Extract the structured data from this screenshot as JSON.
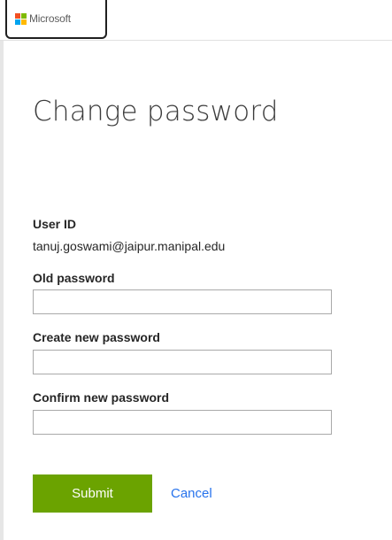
{
  "header": {
    "logo_text": "Microsoft",
    "logo_colors": [
      "#f25022",
      "#7fba00",
      "#00a4ef",
      "#ffb900"
    ]
  },
  "main": {
    "title": "Change password",
    "user_id_label": "User ID",
    "user_id_value": "tanuj.goswami@jaipur.manipal.edu",
    "old_password_label": "Old password",
    "old_password_value": "",
    "new_password_label": "Create new password",
    "new_password_value": "",
    "confirm_password_label": "Confirm new password",
    "confirm_password_value": "",
    "submit_label": "Submit",
    "cancel_label": "Cancel"
  },
  "colors": {
    "accent_button": "#6ba300",
    "link": "#2672ec"
  }
}
